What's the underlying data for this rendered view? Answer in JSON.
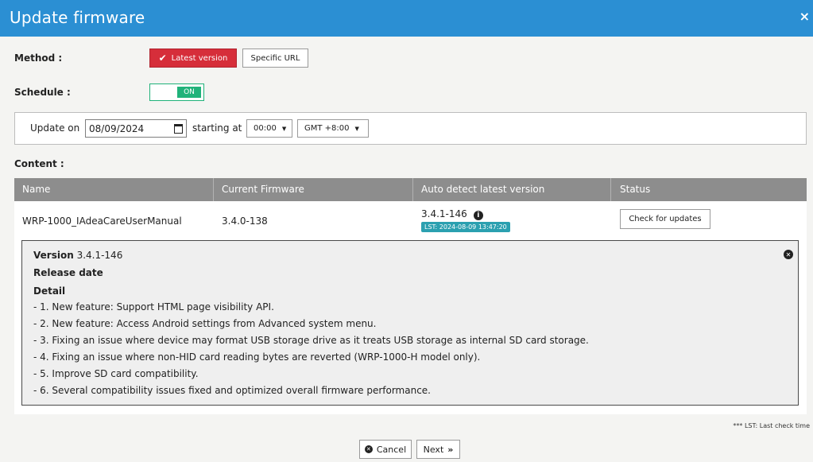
{
  "dialog": {
    "title": "Update firmware",
    "close_icon": "×"
  },
  "method": {
    "label": "Method :",
    "options": [
      "Latest version",
      "Specific URL"
    ],
    "selected": "Latest version",
    "check_icon": "✔",
    "active_color": "#d62e3a"
  },
  "schedule": {
    "label": "Schedule :",
    "toggle_text": "ON",
    "toggle_color": "#20b27a"
  },
  "update": {
    "update_on_label": "Update on",
    "date_value": "08/09/2024",
    "starting_at_label": "starting at",
    "time_value": "00:00",
    "timezone_value": "GMT +8:00"
  },
  "content": {
    "label": "Content :",
    "columns": [
      "Name",
      "Current Firmware",
      "Auto detect latest version",
      "Status"
    ],
    "rows": [
      {
        "name": "WRP-1000_IAdeaCareUserManual",
        "current": "3.4.0-138",
        "latest": "3.4.1-146",
        "lst": "LST: 2024-08-09 13:47:20",
        "status_button": "Check for updates"
      }
    ]
  },
  "details": {
    "version_label": "Version",
    "version_value": "3.4.1-146",
    "release_date_label": "Release date",
    "detail_label": "Detail",
    "lines": [
      "- 1. New feature: Support HTML page visibility API.",
      "- 2. New feature: Access Android settings from Advanced system menu.",
      "- 3. Fixing an issue where device may format USB storage drive as it treats USB storage as internal SD card storage.",
      "- 4. Fixing an issue where non-HID card reading bytes are reverted (WRP-1000-H model only).",
      "- 5. Improve SD card compatibility.",
      "- 6. Several compatibility issues fixed and optimized overall firmware performance."
    ]
  },
  "footnote": "*** LST: Last check time",
  "footer": {
    "cancel_label": "Cancel",
    "next_label": "Next"
  },
  "colors": {
    "title_bar": "#2b8fd3",
    "table_header": "#8d8d8d",
    "badge": "#2ba0b0"
  }
}
